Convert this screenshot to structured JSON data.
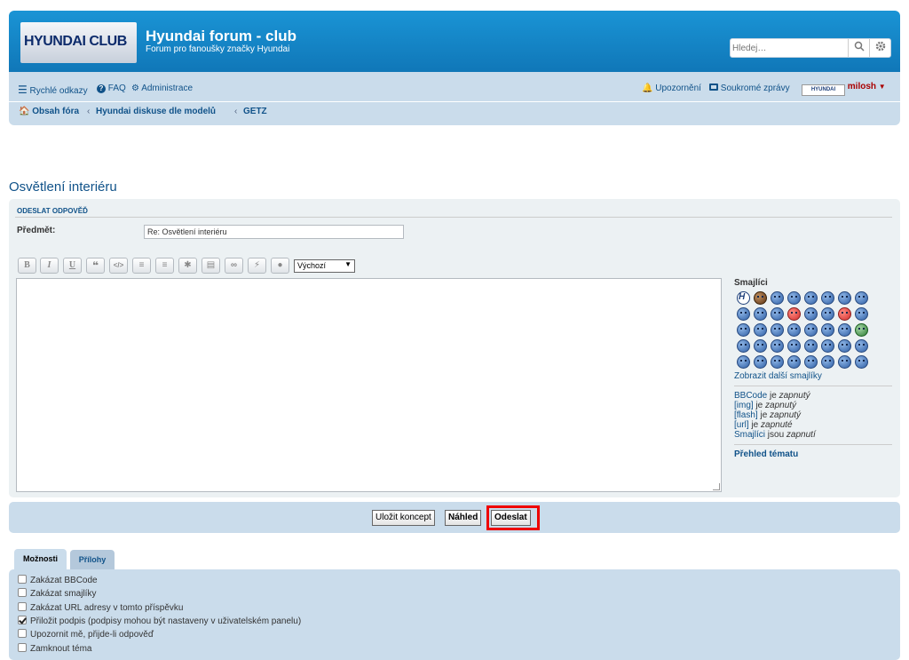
{
  "header": {
    "logo_text": "HYUNDAI CLUB",
    "site_title": "Hyundai forum - club",
    "site_description": "Forum pro fanoušky značky Hyundai",
    "search_placeholder": "Hledej…"
  },
  "navbar": {
    "quick_links": "Rychlé odkazy",
    "faq": "FAQ",
    "admin": "Administrace",
    "notifications": "Upozornění",
    "private_messages": "Soukromé zprávy",
    "username": "milosh",
    "avatar_text": "HYUNDAI"
  },
  "breadcrumbs": [
    "Obsah fóra",
    "Hyundai diskuse dle modelů",
    "GETZ"
  ],
  "topic": {
    "title": "Osvětlení interiéru"
  },
  "post_form": {
    "heading": "Odeslat odpověď",
    "subject_label": "Předmět:",
    "subject_value": "Re: Osvětlení interiéru",
    "font_size_selected": "Výchozí",
    "toolbar_buttons": [
      "B",
      "I",
      "U",
      "quote",
      "code",
      "list",
      "list-numbered",
      "list-item",
      "image",
      "url",
      "flash",
      "color"
    ]
  },
  "smilies": {
    "title": "Smajlíci",
    "more_link": "Zobrazit další smajlíky",
    "count": 40
  },
  "bbcode_status": [
    {
      "label": "BBCode",
      "mid": " je ",
      "status": "zapnutý"
    },
    {
      "label": "[img]",
      "mid": " je ",
      "status": "zapnutý"
    },
    {
      "label": "[flash]",
      "mid": " je ",
      "status": "zapnutý"
    },
    {
      "label": "[url]",
      "mid": " je ",
      "status": "zapnuté"
    },
    {
      "label": "Smajlíci",
      "mid": " jsou ",
      "status": "zapnutí"
    }
  ],
  "topic_review": "Přehled tématu",
  "buttons": {
    "save_draft": "Uložit koncept",
    "preview": "Náhled",
    "submit": "Odeslat"
  },
  "tabs": {
    "options": "Možnosti",
    "attachments": "Přílohy"
  },
  "options": [
    {
      "label": "Zakázat BBCode",
      "checked": false
    },
    {
      "label": "Zakázat smajlíky",
      "checked": false
    },
    {
      "label": "Zakázat URL adresy v tomto příspěvku",
      "checked": false
    },
    {
      "label": "Přiložit podpis (podpisy mohou být nastaveny v uživatelském panelu)",
      "checked": true
    },
    {
      "label": "Upozornit mě, přijde-li odpověď",
      "checked": false
    },
    {
      "label": "Zamknout téma",
      "checked": false
    }
  ],
  "colors": {
    "header_blue": "#1077b8",
    "nav_bg": "#cadceb",
    "panel_bg": "#ecf1f3",
    "link": "#105289",
    "highlight_red": "#e00000"
  }
}
